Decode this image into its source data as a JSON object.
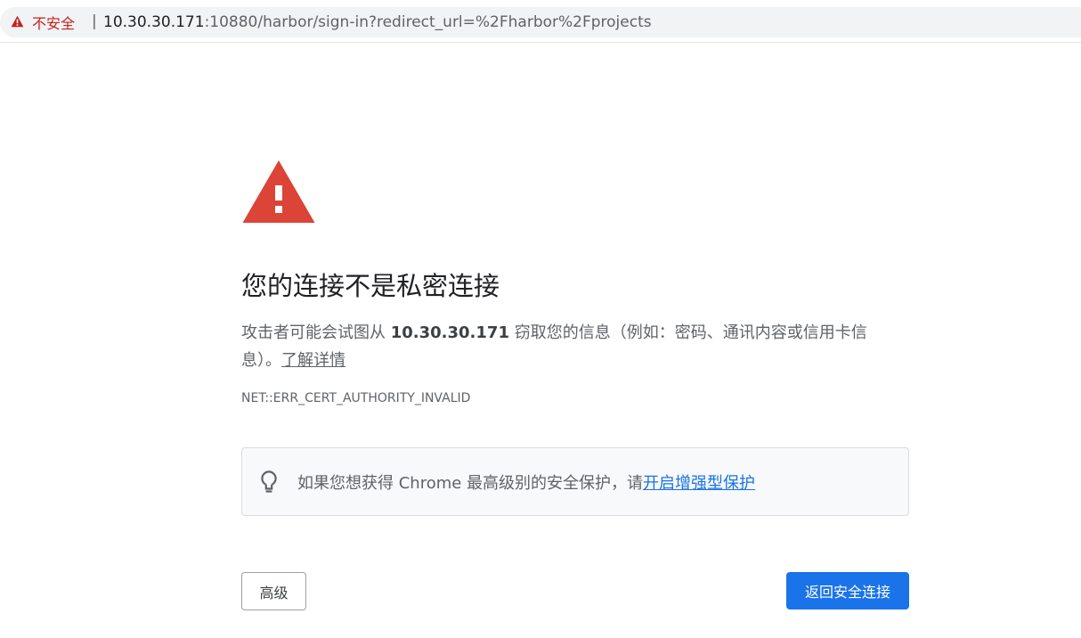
{
  "browser": {
    "security_label": "不安全",
    "separator": "|",
    "url_host": "10.30.30.171",
    "url_rest": ":10880/harbor/sign-in?redirect_url=%2Fharbor%2Fprojects",
    "security_icon": "warning-triangle-icon"
  },
  "interstitial": {
    "icon": "warning-triangle-icon",
    "heading": "您的连接不是私密连接",
    "desc_before": "攻击者可能会试图从 ",
    "desc_host": "10.30.30.171",
    "desc_after": " 窃取您的信息（例如：密码、通讯内容或信用卡信息）。",
    "learn_more": "了解详情",
    "error_code": "NET::ERR_CERT_AUTHORITY_INVALID",
    "enhanced": {
      "icon": "lightbulb-icon",
      "text": "如果您想获得 Chrome 最高级别的安全保护，请",
      "link": "开启增强型保护"
    },
    "buttons": {
      "advanced": "高级",
      "back_to_safety": "返回安全连接"
    }
  },
  "colors": {
    "warning_red": "#db4437",
    "link_blue": "#1a73e8",
    "primary_button": "#1a73e8",
    "insecure_text": "#c5221f"
  }
}
